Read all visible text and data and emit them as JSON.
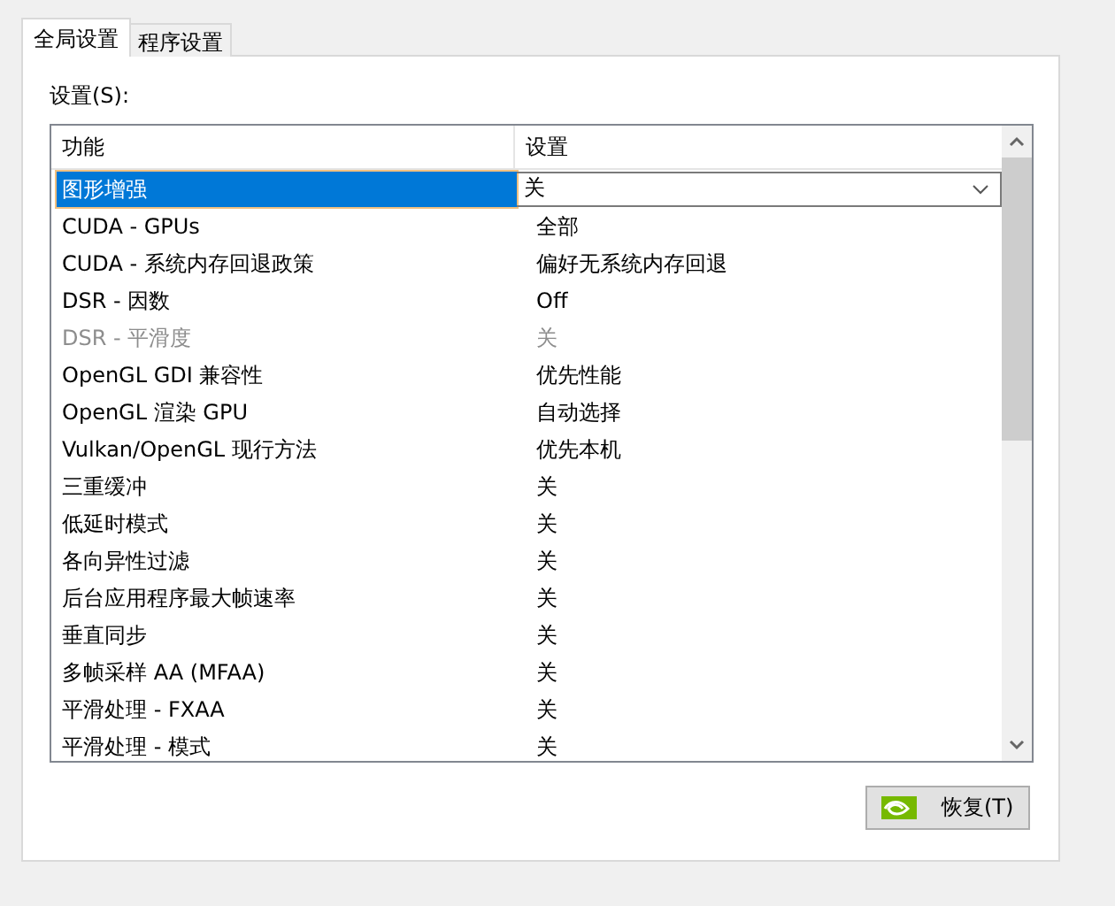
{
  "tabs": [
    {
      "label": "全局设置",
      "selected": true
    },
    {
      "label": "程序设置",
      "selected": false
    }
  ],
  "settings_label": "设置(S):",
  "table": {
    "columns": [
      "功能",
      "设置"
    ],
    "rows": [
      {
        "feature": "图形增强",
        "value": "关",
        "selected": true,
        "disabled": false
      },
      {
        "feature": "CUDA - GPUs",
        "value": "全部",
        "selected": false,
        "disabled": false
      },
      {
        "feature": "CUDA - 系统内存回退政策",
        "value": "偏好无系统内存回退",
        "selected": false,
        "disabled": false
      },
      {
        "feature": "DSR - 因数",
        "value": "Off",
        "selected": false,
        "disabled": false
      },
      {
        "feature": "DSR - 平滑度",
        "value": "关",
        "selected": false,
        "disabled": true
      },
      {
        "feature": "OpenGL GDI 兼容性",
        "value": "优先性能",
        "selected": false,
        "disabled": false
      },
      {
        "feature": "OpenGL 渲染 GPU",
        "value": "自动选择",
        "selected": false,
        "disabled": false
      },
      {
        "feature": "Vulkan/OpenGL 现行方法",
        "value": "优先本机",
        "selected": false,
        "disabled": false
      },
      {
        "feature": "三重缓冲",
        "value": "关",
        "selected": false,
        "disabled": false
      },
      {
        "feature": "低延时模式",
        "value": "关",
        "selected": false,
        "disabled": false
      },
      {
        "feature": "各向异性过滤",
        "value": "关",
        "selected": false,
        "disabled": false
      },
      {
        "feature": "后台应用程序最大帧速率",
        "value": "关",
        "selected": false,
        "disabled": false
      },
      {
        "feature": "垂直同步",
        "value": "关",
        "selected": false,
        "disabled": false
      },
      {
        "feature": "多帧采样 AA (MFAA)",
        "value": "关",
        "selected": false,
        "disabled": false
      },
      {
        "feature": "平滑处理 - FXAA",
        "value": "关",
        "selected": false,
        "disabled": false
      },
      {
        "feature": "平滑处理 - 模式",
        "value": "关",
        "selected": false,
        "disabled": false
      }
    ]
  },
  "restore_button": "恢复(T)"
}
